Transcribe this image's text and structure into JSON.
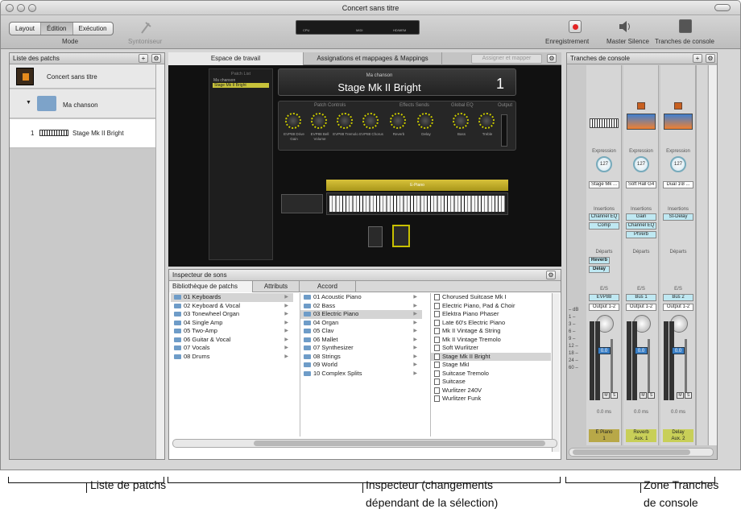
{
  "window": {
    "title": "Concert sans titre"
  },
  "toolbar": {
    "mode_tabs": [
      "Layout",
      "Édition",
      "Exécution"
    ],
    "mode_selected": "Édition",
    "mode_label": "Mode",
    "tuner_label": "Syntoniseur",
    "lcd": {
      "cpu": "CPU",
      "midi": "MIDI",
      "hd": "HD/MEM"
    },
    "record_label": "Enregistrement",
    "master_silence_label": "Master Silence",
    "console_label": "Tranches de console"
  },
  "patch_list": {
    "title": "Liste des patchs",
    "add": "+",
    "gear": "⚙",
    "concert": "Concert sans titre",
    "song": "Ma chanson",
    "patch_number": "1",
    "patch_name": "Stage Mk II Bright"
  },
  "tabs": {
    "workspace": "Espace de travail",
    "mappings": "Assignations et mappages & Mappings",
    "assign_button": "Assigner et mapper"
  },
  "workspace": {
    "patch_list_title": "Patch List",
    "patch_list_items": [
      "Ma chanson",
      "Stage Mk II Bright"
    ],
    "song": "Ma chanson",
    "patch": "Stage Mk II Bright",
    "number": "1",
    "section_patch": "Patch Controls",
    "section_effects": "Effects Sends",
    "section_eq": "Global EQ",
    "section_output": "Output",
    "knobs": [
      "EVP88 Drive Gain",
      "EVP88 Bell Volume",
      "EVP88 Tremolo",
      "EVP88 Chorus",
      "Reverb",
      "Delay",
      "Bass",
      "Treble"
    ],
    "keyboard_label": "E-Piano"
  },
  "inspector": {
    "title": "Inspecteur de sons",
    "tabs": [
      "Bibliothèque de patchs",
      "Attributs",
      "Accord"
    ],
    "categories": [
      "01 Keyboards",
      "02 Keyboard & Vocal",
      "03 Tonewheel Organ",
      "04 Single Amp",
      "05 Two-Amp",
      "06 Guitar & Vocal",
      "07 Vocals",
      "08 Drums"
    ],
    "subcategories": [
      "01 Acoustic Piano",
      "02 Bass",
      "03 Electric Piano",
      "04 Organ",
      "05 Clav",
      "06 Mallet",
      "07 Synthesizer",
      "08 Strings",
      "09 World",
      "10 Complex Splits"
    ],
    "patches": [
      "Chorused Suitcase Mk I",
      "Electric Piano, Pad & Choir",
      "Elektra Piano Phaser",
      "Late 60's Electric Piano",
      "Mk II Vintage & String",
      "Mk II Vintage Tremolo",
      "Soft Wurlitzer",
      "Stage Mk II Bright",
      "Stage MkI",
      "Suitcase Tremolo",
      "Suitcase",
      "Wurlitzer 240V",
      "Wurlitzer Funk"
    ],
    "selected_category": "01 Keyboards",
    "selected_subcategory": "03 Electric Piano",
    "selected_patch": "Stage Mk II Bright"
  },
  "console": {
    "title": "Tranches de console",
    "expression_label": "Expression",
    "inserts_label": "Insertions",
    "sends_label": "Départs",
    "io_label": "E/S",
    "db_label": "– dB",
    "scale": [
      "1 –",
      "3 –",
      "6 –",
      "9 –",
      "12 –",
      "18 –",
      "24 –",
      "60 –"
    ],
    "strips": [
      {
        "name": "E Piano",
        "sub": "1",
        "instrument": "Stage Mk ...",
        "expression": "127",
        "inserts": [
          "Channel EQ",
          "Comp"
        ],
        "sends": [
          "Reverb",
          "Delay"
        ],
        "input": "EVP88",
        "output": "Output 1-2",
        "volume": "0.0",
        "delay": "0.0 ms"
      },
      {
        "name": "Reverb",
        "sub": "Aux. 1",
        "instrument": "Soft Hall G4",
        "expression": "127",
        "inserts": [
          "Gain",
          "Channel EQ",
          "PtVerb"
        ],
        "sends": [],
        "input": "Bus 1",
        "output": "Output 1-2",
        "volume": "0.0",
        "delay": "0.0 ms"
      },
      {
        "name": "Delay",
        "sub": "Aux. 2",
        "instrument": "Dual 1\\8 ...",
        "expression": "127",
        "inserts": [
          "St-Delay"
        ],
        "sends": [],
        "input": "Bus 2",
        "output": "Output 1-2",
        "volume": "0.0",
        "delay": "0.0 ms"
      }
    ]
  },
  "annotations": {
    "left": "Liste de patchs",
    "middle_1": "Inspecteur (changements",
    "middle_2": "dépendant de la sélection)",
    "right_1": "Zone Tranches",
    "right_2": "de console"
  },
  "colors": {
    "record": "#e32424",
    "knob_accent": "#c8c800",
    "badge": "#c8cf58",
    "insert": "#bfe8f2"
  }
}
